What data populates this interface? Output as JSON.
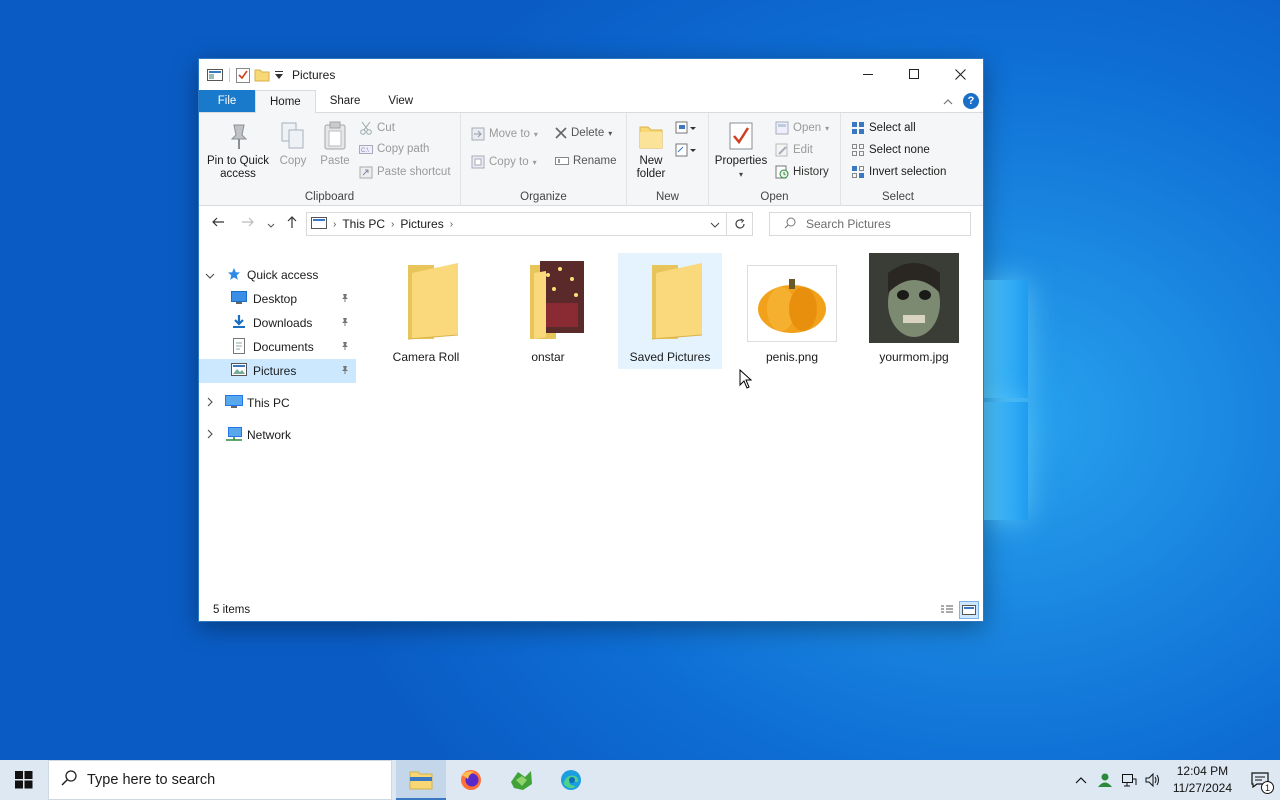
{
  "window": {
    "title": "Pictures",
    "tabs": {
      "file": "File",
      "home": "Home",
      "share": "Share",
      "view": "View"
    },
    "help": "?"
  },
  "ribbon": {
    "clipboard": {
      "label": "Clipboard",
      "pin": "Pin to Quick access",
      "copy": "Copy",
      "paste": "Paste",
      "cut": "Cut",
      "copy_path": "Copy path",
      "paste_shortcut": "Paste shortcut"
    },
    "organize": {
      "label": "Organize",
      "move_to": "Move to",
      "copy_to": "Copy to",
      "delete": "Delete",
      "rename": "Rename"
    },
    "new": {
      "label": "New",
      "new_folder": "New folder"
    },
    "open": {
      "label": "Open",
      "properties": "Properties",
      "open": "Open",
      "edit": "Edit",
      "history": "History"
    },
    "select": {
      "label": "Select",
      "select_all": "Select all",
      "select_none": "Select none",
      "invert": "Invert selection"
    }
  },
  "address": {
    "crumbs": [
      "This PC",
      "Pictures"
    ],
    "search_placeholder": "Search Pictures"
  },
  "nav": {
    "quick_access": "Quick access",
    "items": [
      {
        "label": "Desktop"
      },
      {
        "label": "Downloads"
      },
      {
        "label": "Documents"
      },
      {
        "label": "Pictures"
      }
    ],
    "this_pc": "This PC",
    "network": "Network"
  },
  "files": [
    {
      "name": "Camera Roll",
      "type": "folder"
    },
    {
      "name": "onstar",
      "type": "folder"
    },
    {
      "name": "Saved Pictures",
      "type": "folder"
    },
    {
      "name": "penis.png",
      "type": "image"
    },
    {
      "name": "yourmom.jpg",
      "type": "image"
    }
  ],
  "status": {
    "count": "5 items"
  },
  "taskbar": {
    "search_placeholder": "Type here to search",
    "time": "12:04 PM",
    "date": "11/27/2024",
    "notifications": "1"
  }
}
